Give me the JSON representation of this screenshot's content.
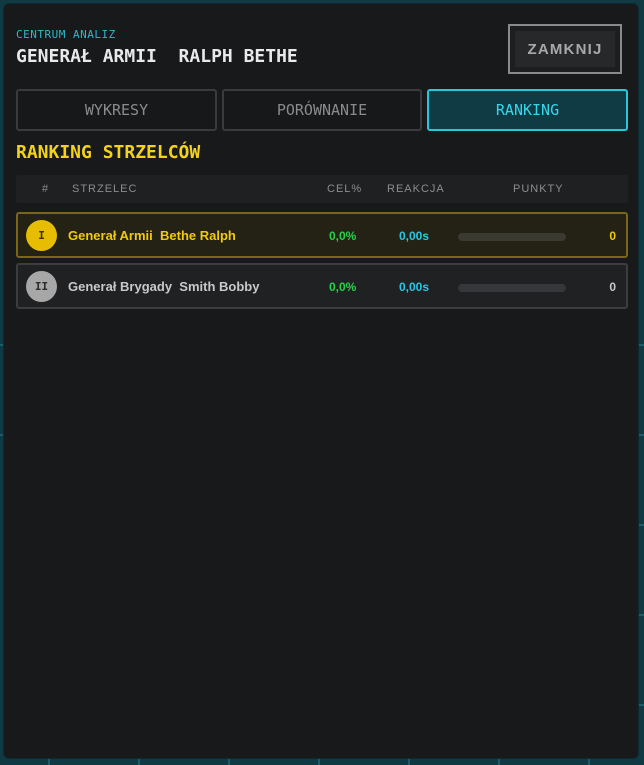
{
  "header": {
    "subtitle": "CENTRUM ANALIZ",
    "title": "GENERAŁ ARMII  RALPH BETHE",
    "close_label": "ZAMKNIJ"
  },
  "tabs": [
    {
      "label": "WYKRESY",
      "active": false
    },
    {
      "label": "PORÓWNANIE",
      "active": false
    },
    {
      "label": "RANKING",
      "active": true
    }
  ],
  "ranking": {
    "title": "RANKING STRZELCÓW",
    "columns": {
      "num": "#",
      "name": "STRZELEC",
      "accuracy": "CEL%",
      "reaction": "REAKCJA",
      "points": "PUNKTY"
    },
    "rows": [
      {
        "rank": "I",
        "name": "Generał Armii  Bethe Ralph",
        "accuracy": "0,0%",
        "reaction": "0,00s",
        "points": "0",
        "progress": 0
      },
      {
        "rank": "II",
        "name": "Generał Brygady  Smith Bobby",
        "accuracy": "0,0%",
        "reaction": "0,00s",
        "points": "0",
        "progress": 0
      }
    ]
  },
  "colors": {
    "accent": "#26c8dc",
    "gold": "#f2ca0c",
    "green": "#25d24a"
  }
}
